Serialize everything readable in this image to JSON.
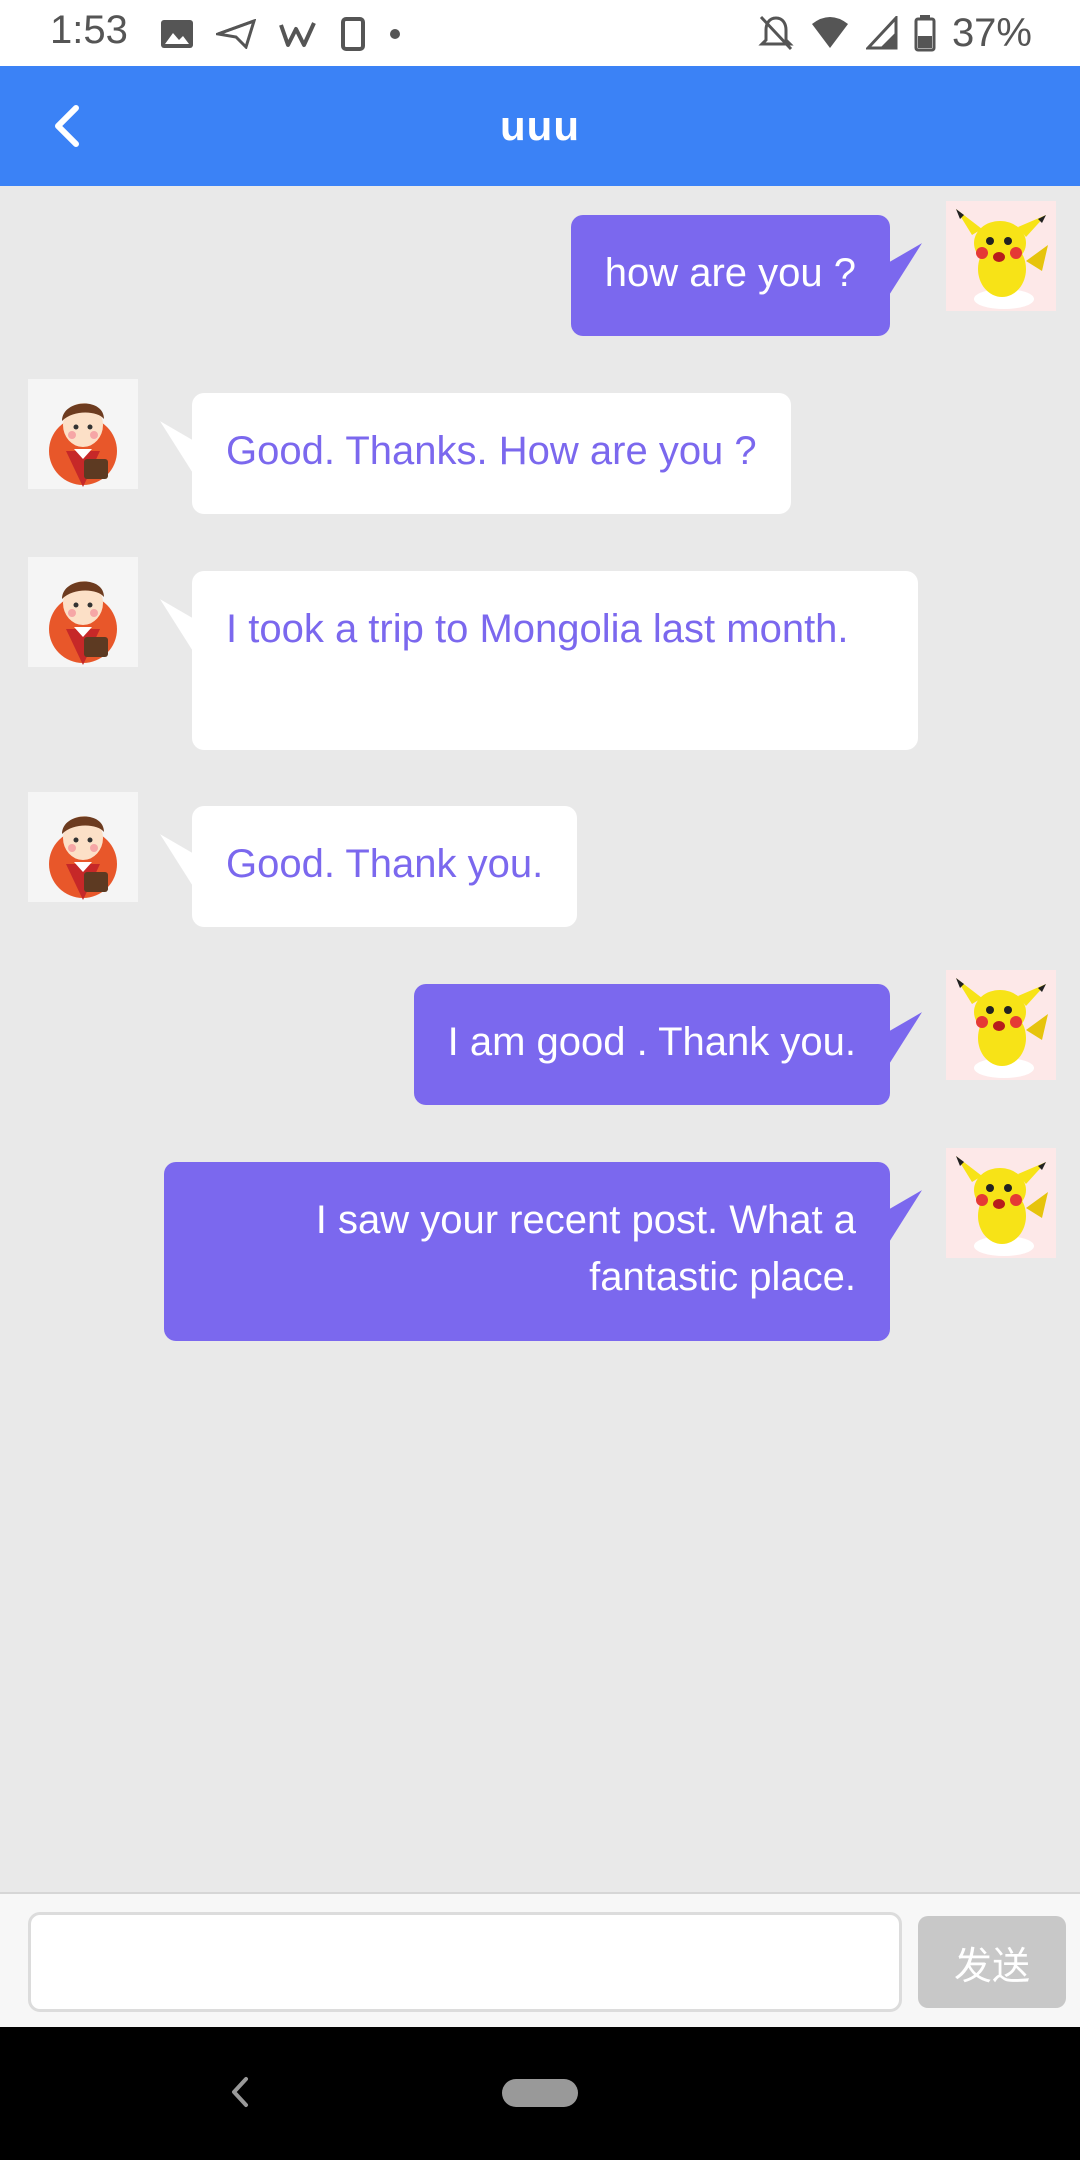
{
  "status_bar": {
    "time": "1:53",
    "battery": "37%",
    "icons_left": [
      "image-icon",
      "send-icon",
      "w-icon",
      "phone-outline-icon",
      "dot-icon"
    ],
    "icons_right": [
      "bell-off-icon",
      "wifi-icon",
      "signal-icon",
      "battery-icon"
    ]
  },
  "header": {
    "title": "uuu",
    "bg_color": "#3b82f6"
  },
  "messages": [
    {
      "sender": "self",
      "text": "how are you ?"
    },
    {
      "sender": "other",
      "text": "Good. Thanks. How are you ?"
    },
    {
      "sender": "other",
      "text": "I took a trip to Mongolia last month."
    },
    {
      "sender": "other",
      "text": "Good. Thank you."
    },
    {
      "sender": "self",
      "text": "I am good . Thank you."
    },
    {
      "sender": "self",
      "text": "I saw your recent post. What a fantastic place."
    }
  ],
  "colors": {
    "self_bubble": "#7b68ee",
    "other_text": "#7b68ee",
    "chat_bg": "#e9e9e9"
  },
  "input": {
    "value": "",
    "send_label": "发送"
  }
}
